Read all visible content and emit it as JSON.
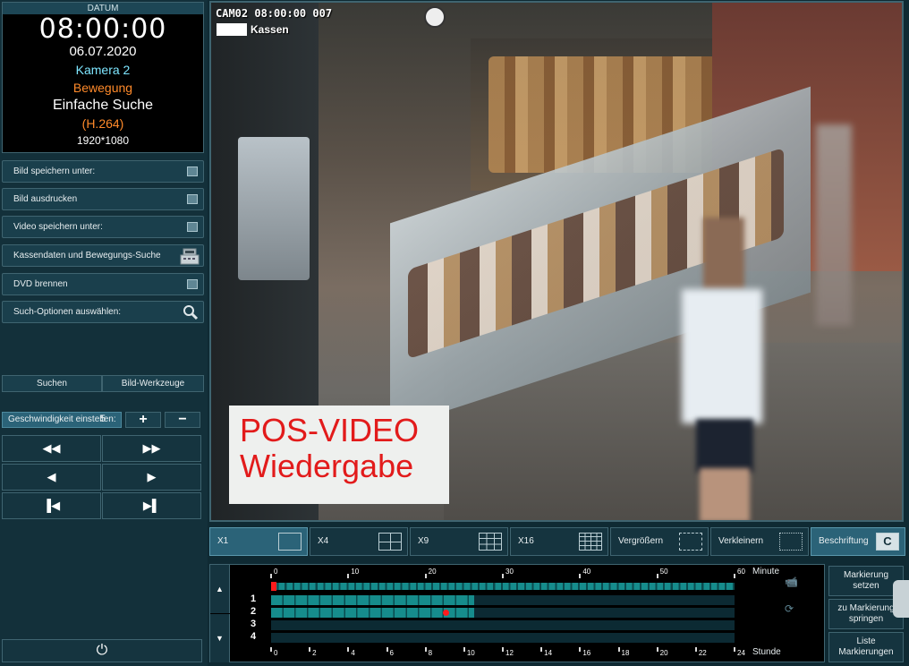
{
  "info": {
    "header": "DATUM",
    "time": "08:00:00",
    "date": "06.07.2020",
    "camera": "Kamera 2",
    "event": "Bewegung",
    "search_mode": "Einfache Suche",
    "codec": "(H.264)",
    "resolution": "1920*1080"
  },
  "menu": {
    "save_image": "Bild speichern unter:",
    "print_image": "Bild ausdrucken",
    "save_video": "Video speichern unter:",
    "pos_motion_search": "Kassendaten und Bewegungs-Suche",
    "burn_dvd": "DVD brennen",
    "search_options": "Such-Optionen auswählen:"
  },
  "actions": {
    "search": "Suchen",
    "image_tools": "Bild-Werkzeuge"
  },
  "speed": {
    "label": "Geschwindigkeit einstellen:",
    "value": "5",
    "plus": "+",
    "minus": "−"
  },
  "playback": {
    "fast_rewind": "◀◀",
    "fast_forward": "▶▶",
    "step_back": "◀",
    "play": "▶",
    "to_start": "▐◀",
    "to_end": "▶▌",
    "power": "⏻"
  },
  "video": {
    "osd_line": "CAM02 08:00:00 007",
    "osd_sub": "Kassen",
    "overlay_line1": "POS-VIDEO",
    "overlay_line2": "Wiedergabe"
  },
  "views": {
    "x1": "X1",
    "x4": "X4",
    "x9": "X9",
    "x16": "X16",
    "zoom_in": "Vergrößern",
    "zoom_out": "Verkleinern",
    "caption": "Beschriftung",
    "caption_key": "C"
  },
  "timeline": {
    "minute_label": "Minute",
    "hour_label": "Stunde",
    "minute_ticks": [
      "0",
      "10",
      "20",
      "30",
      "40",
      "50",
      "60"
    ],
    "hour_ticks": [
      "0",
      "2",
      "4",
      "6",
      "8",
      "10",
      "12",
      "14",
      "16",
      "18",
      "20",
      "22",
      "24"
    ],
    "rows": [
      "1",
      "2",
      "3",
      "4"
    ],
    "up_arrow": "▲",
    "down_arrow": "▼",
    "recorded_until_hour": 10.5,
    "motion_marker_hour": 8
  },
  "markers": {
    "set": "Markierung setzen",
    "jump": "zu Markierung springen",
    "list": "Liste Markierungen"
  },
  "colors": {
    "accent": "#2b6378",
    "track": "#168c8c",
    "alert": "#ff1c1c",
    "overlay_text": "#e21b1b"
  }
}
